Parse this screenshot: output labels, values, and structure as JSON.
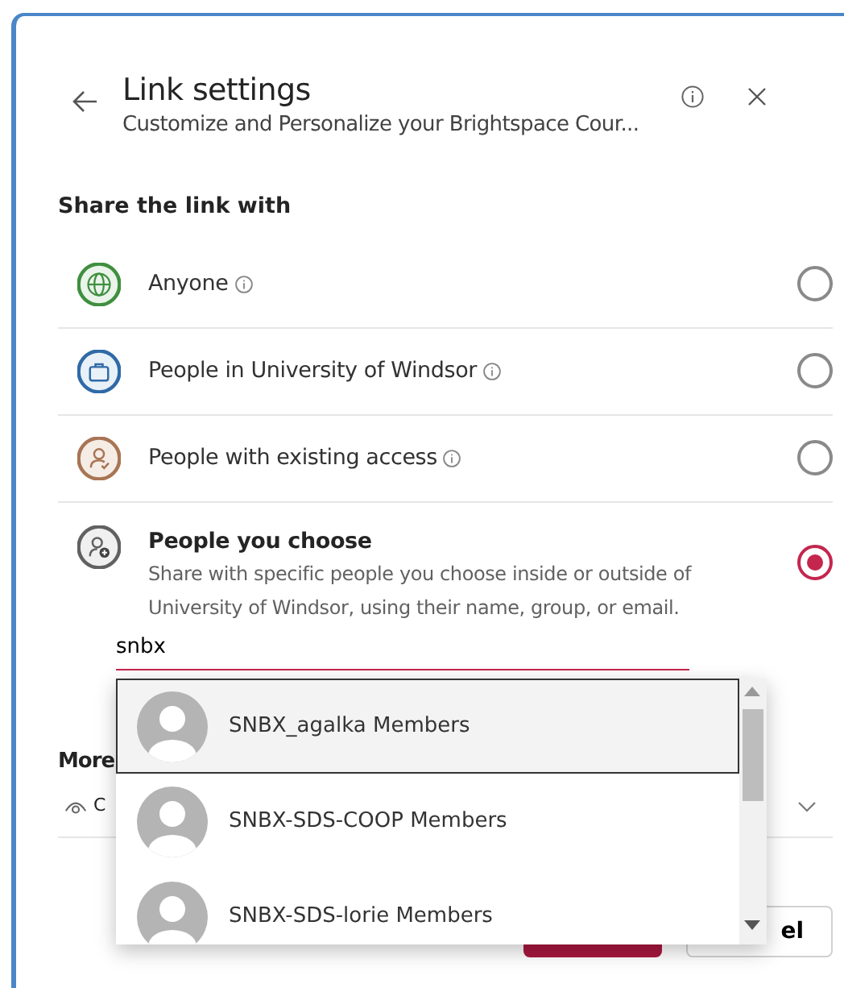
{
  "header": {
    "title": "Link settings",
    "subtitle": "Customize and Personalize your Brightspace Cour..."
  },
  "section_title": "Share the link with",
  "options": [
    {
      "kind": "globe",
      "label": "Anyone",
      "info": true,
      "selected": false,
      "color": "#3f8f3f"
    },
    {
      "kind": "briefcase",
      "label": "People in University of Windsor",
      "info": true,
      "selected": false,
      "color": "#2f6aa6"
    },
    {
      "kind": "person-check",
      "label": "People with existing access",
      "info": true,
      "selected": false,
      "color": "#a87554"
    },
    {
      "kind": "people-add",
      "label": "People you choose",
      "info": false,
      "selected": true,
      "color": "#616161",
      "description": "Share with specific people you choose inside or outside of University of Windsor, using their name, group, or email."
    }
  ],
  "search": {
    "value": "snbx"
  },
  "suggestions": [
    {
      "name": "SNBX_agalka Members",
      "selected": true
    },
    {
      "name": "SNBX-SDS-COOP Members",
      "selected": false
    },
    {
      "name": "SNBX-SDS-lorie Members",
      "selected": false
    }
  ],
  "more": {
    "title": "More",
    "setting_label": "C"
  },
  "buttons": [
    {
      "kind": "primary"
    },
    {
      "kind": "secondary",
      "label": "el"
    }
  ]
}
